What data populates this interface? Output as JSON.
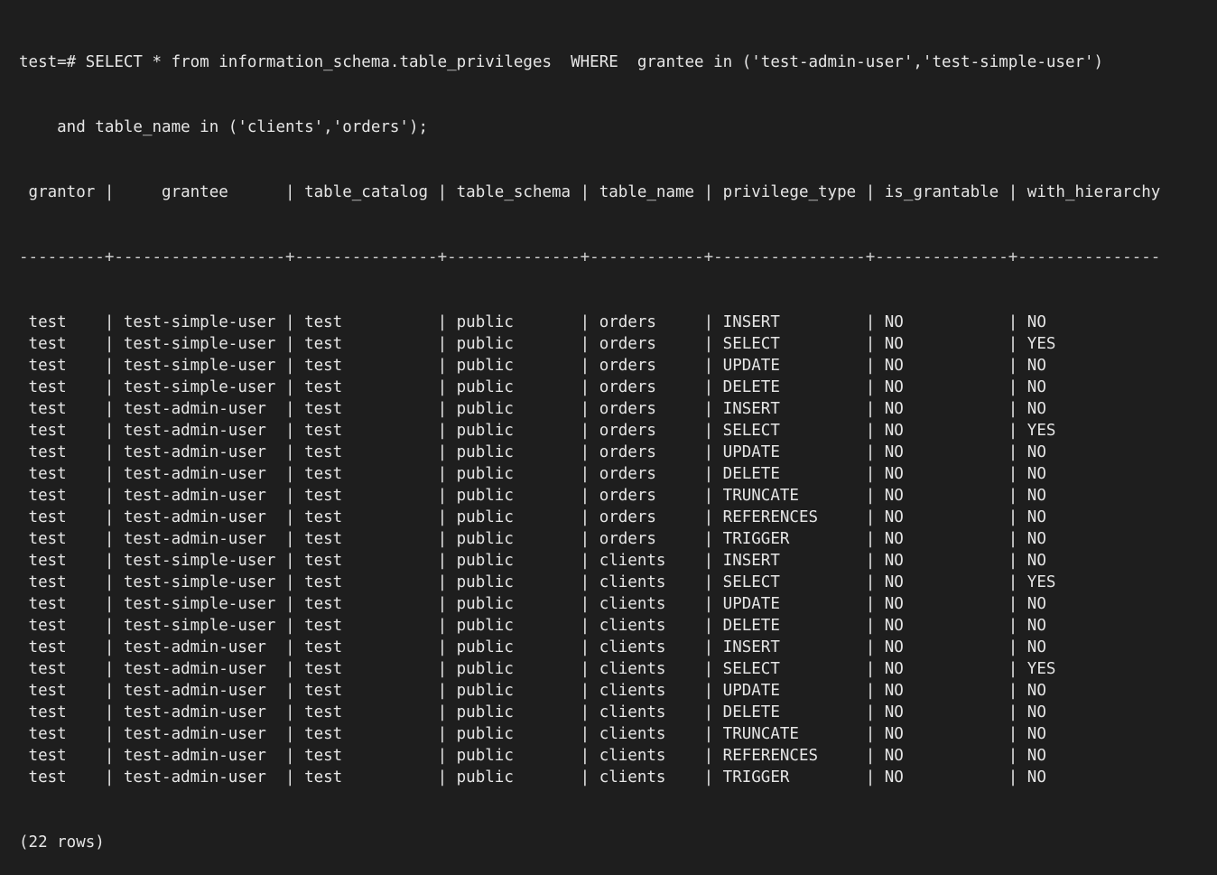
{
  "terminal": {
    "prompt": "test=#",
    "query_line1": " SELECT * from information_schema.table_privileges  WHERE  grantee in ('test-admin-user','test-simple-user')",
    "query_line2": "    and table_name in ('clients','orders');",
    "header_line": " grantor |     grantee      | table_catalog | table_schema | table_name | privilege_type | is_grantable | with_hierarchy",
    "divider_line": "---------+------------------+---------------+--------------+------------+----------------+--------------+---------------",
    "footer": "(22 rows)"
  },
  "table": {
    "columns": [
      "grantor",
      "grantee",
      "table_catalog",
      "table_schema",
      "table_name",
      "privilege_type",
      "is_grantable",
      "with_hierarchy"
    ],
    "rows": [
      [
        " test    | test-simple-user | test          | public       | orders     | INSERT         | NO           | NO"
      ],
      [
        " test    | test-simple-user | test          | public       | orders     | SELECT         | NO           | YES"
      ],
      [
        " test    | test-simple-user | test          | public       | orders     | UPDATE         | NO           | NO"
      ],
      [
        " test    | test-simple-user | test          | public       | orders     | DELETE         | NO           | NO"
      ],
      [
        " test    | test-admin-user  | test          | public       | orders     | INSERT         | NO           | NO"
      ],
      [
        " test    | test-admin-user  | test          | public       | orders     | SELECT         | NO           | YES"
      ],
      [
        " test    | test-admin-user  | test          | public       | orders     | UPDATE         | NO           | NO"
      ],
      [
        " test    | test-admin-user  | test          | public       | orders     | DELETE         | NO           | NO"
      ],
      [
        " test    | test-admin-user  | test          | public       | orders     | TRUNCATE       | NO           | NO"
      ],
      [
        " test    | test-admin-user  | test          | public       | orders     | REFERENCES     | NO           | NO"
      ],
      [
        " test    | test-admin-user  | test          | public       | orders     | TRIGGER        | NO           | NO"
      ],
      [
        " test    | test-simple-user | test          | public       | clients    | INSERT         | NO           | NO"
      ],
      [
        " test    | test-simple-user | test          | public       | clients    | SELECT         | NO           | YES"
      ],
      [
        " test    | test-simple-user | test          | public       | clients    | UPDATE         | NO           | NO"
      ],
      [
        " test    | test-simple-user | test          | public       | clients    | DELETE         | NO           | NO"
      ],
      [
        " test    | test-admin-user  | test          | public       | clients    | INSERT         | NO           | NO"
      ],
      [
        " test    | test-admin-user  | test          | public       | clients    | SELECT         | NO           | YES"
      ],
      [
        " test    | test-admin-user  | test          | public       | clients    | UPDATE         | NO           | NO"
      ],
      [
        " test    | test-admin-user  | test          | public       | clients    | DELETE         | NO           | NO"
      ],
      [
        " test    | test-admin-user  | test          | public       | clients    | TRUNCATE       | NO           | NO"
      ],
      [
        " test    | test-admin-user  | test          | public       | clients    | REFERENCES     | NO           | NO"
      ],
      [
        " test    | test-admin-user  | test          | public       | clients    | TRIGGER        | NO           | NO"
      ]
    ]
  },
  "colors": {
    "background": "#1e1e1e",
    "text": "#e6e6e6"
  }
}
